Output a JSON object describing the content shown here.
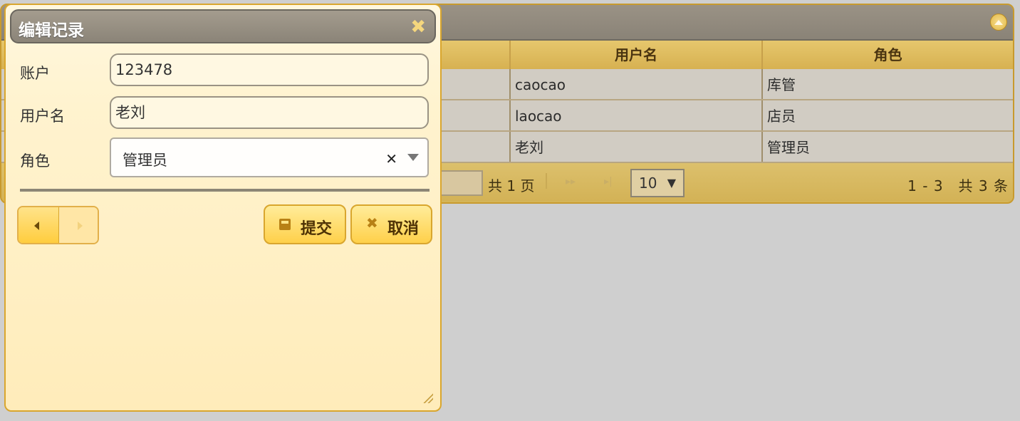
{
  "grid": {
    "columns": [
      "用户名",
      "角色"
    ],
    "rows": [
      {
        "username": "caocao",
        "role": "库管"
      },
      {
        "username": "laocao",
        "role": "店员"
      },
      {
        "username": "老刘",
        "role": "管理员"
      }
    ],
    "pager": {
      "total_pages": "共 1 页",
      "page_size": "10",
      "info": "1 - 3　共 3 条"
    }
  },
  "dialog": {
    "title": "编辑记录",
    "fields": {
      "account": {
        "label": "账户",
        "value": "123478"
      },
      "username": {
        "label": "用户名",
        "value": "老刘"
      },
      "role": {
        "label": "角色",
        "value": "管理员"
      }
    },
    "buttons": {
      "submit": "提交",
      "cancel": "取消"
    }
  },
  "icons": {
    "close": "close-icon",
    "collapse": "collapse-icon",
    "prev": "prev-record-icon",
    "next": "next-record-icon",
    "save": "save-icon",
    "cancel": "cancel-icon"
  }
}
